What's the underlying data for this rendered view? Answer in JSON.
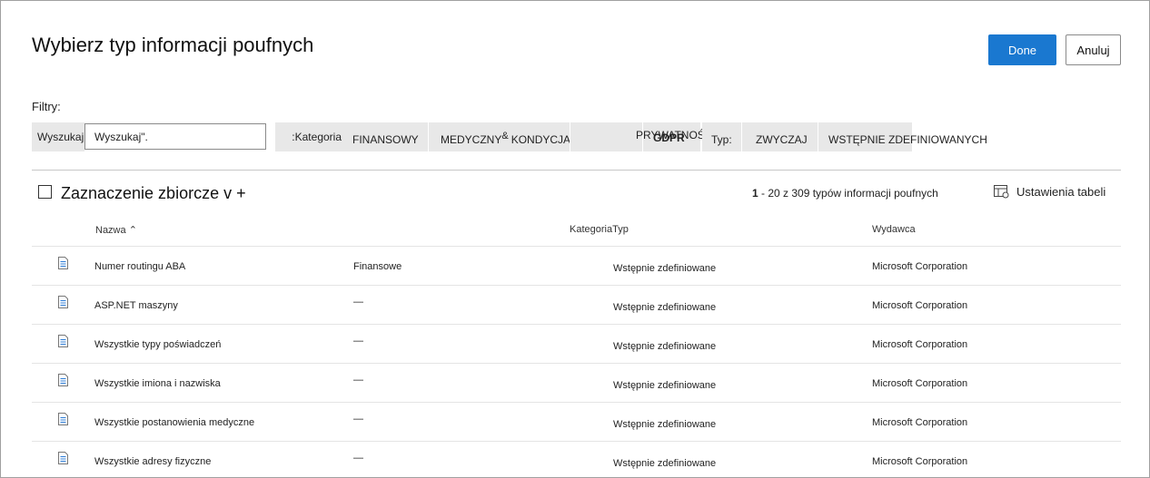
{
  "dialog": {
    "title": "Wybierz typ informacji poufnych",
    "done_label": "Done",
    "cancel_label": "Anuluj"
  },
  "filters": {
    "label": "Filtry:",
    "search_label": "Wyszukaj:",
    "search_value": "Wyszukaj\".",
    "category_label": ":Kategoria",
    "categories": [
      "FINANSOWY",
      "MEDYCZNY",
      "&",
      "KONDYCJA",
      "PRYWATNOŚĆ",
      "GDPR"
    ],
    "type_label": "Typ:",
    "types": [
      "ZWYCZAJ",
      "WSTĘPNIE ZDEFINIOWANYCH"
    ]
  },
  "toolbar": {
    "bulk_select": "Zaznaczenie zbiorcze v +",
    "count_bold": "1",
    "count_rest": " - 20 z 309 typów informacji poufnych",
    "table_settings": "Ustawienia tabeli"
  },
  "table": {
    "headers": {
      "name": "Nazwa",
      "category_type": "KategoriaTyp",
      "publisher": "Wydawca"
    },
    "rows": [
      {
        "name": "Numer routingu ABA",
        "category": "Finansowe",
        "type": "Wstępnie zdefiniowane",
        "publisher": "Microsoft Corporation"
      },
      {
        "name": "ASP.NET maszyny",
        "category": "—",
        "type": "Wstępnie zdefiniowane",
        "publisher": "Microsoft Corporation"
      },
      {
        "name": "Wszystkie typy poświadczeń",
        "category": "—",
        "type": "Wstępnie zdefiniowane",
        "publisher": "Microsoft Corporation"
      },
      {
        "name": "Wszystkie imiona i nazwiska",
        "category": "—",
        "type": "Wstępnie zdefiniowane",
        "publisher": "Microsoft Corporation"
      },
      {
        "name": "Wszystkie postanowienia medyczne",
        "category": "—",
        "type": "Wstępnie zdefiniowane",
        "publisher": "Microsoft Corporation"
      },
      {
        "name": "Wszystkie adresy fizyczne",
        "category": "—",
        "type": "Wstępnie zdefiniowane",
        "publisher": "Microsoft Corporation"
      }
    ]
  }
}
